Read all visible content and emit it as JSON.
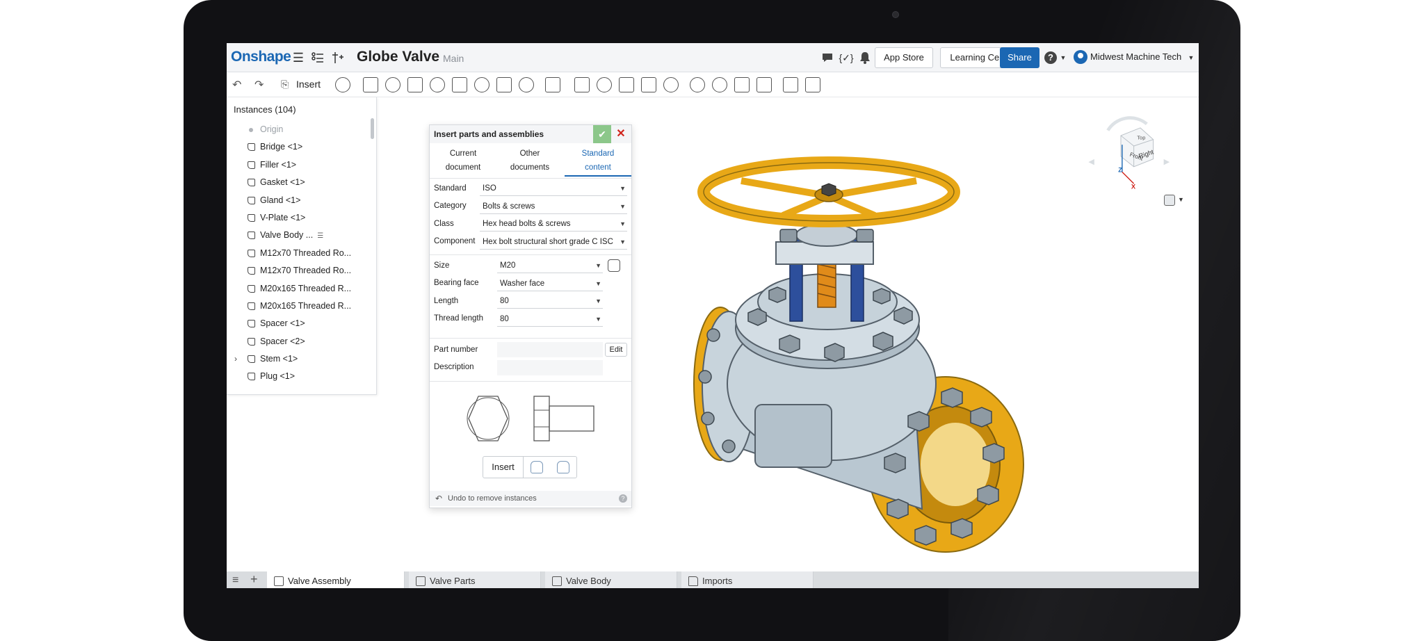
{
  "app": {
    "logo": "Onshape",
    "document_title": "Globe Valve",
    "branch": "Main"
  },
  "topbar": {
    "app_store": "App Store",
    "learning_center": "Learning Center",
    "share": "Share",
    "user": "Midwest Machine Tech",
    "help": "?"
  },
  "toolbar": {
    "insert_label": "Insert"
  },
  "instances": {
    "title": "Instances (104)",
    "items": [
      {
        "label": "Origin"
      },
      {
        "label": "Bridge <1>"
      },
      {
        "label": "Filler <1>"
      },
      {
        "label": "Gasket <1>"
      },
      {
        "label": "Gland <1>"
      },
      {
        "label": "V-Plate <1>"
      },
      {
        "label": "Valve Body ..."
      },
      {
        "label": "M12x70 Threaded Ro..."
      },
      {
        "label": "M12x70 Threaded Ro..."
      },
      {
        "label": "M20x165 Threaded R..."
      },
      {
        "label": "M20x165 Threaded R..."
      },
      {
        "label": "Spacer <1>"
      },
      {
        "label": "Spacer <2>"
      },
      {
        "label": "Stem <1>"
      },
      {
        "label": "Plug <1>"
      }
    ]
  },
  "dialog": {
    "title": "Insert parts and assemblies",
    "tabs": [
      {
        "line1": "Current",
        "line2": "document"
      },
      {
        "line1": "Other",
        "line2": "documents"
      },
      {
        "line1": "Standard",
        "line2": "content"
      }
    ],
    "fields": [
      {
        "label": "Standard",
        "value": "ISO"
      },
      {
        "label": "Category",
        "value": "Bolts & screws"
      },
      {
        "label": "Class",
        "value": "Hex head bolts & screws"
      },
      {
        "label": "Component",
        "value": "Hex bolt structural short grade C ISC"
      }
    ],
    "params": [
      {
        "label": "Size",
        "value": "M20"
      },
      {
        "label": "Bearing face",
        "value": "Washer face"
      },
      {
        "label": "Length",
        "value": "80"
      },
      {
        "label": "Thread length",
        "value": "80"
      }
    ],
    "part_number_label": "Part number",
    "description_label": "Description",
    "edit_label": "Edit",
    "insert_label": "Insert",
    "footer": "Undo to remove instances"
  },
  "viewcube": {
    "z": "Z",
    "x": "X",
    "front": "Front",
    "right": "Right",
    "top": "Top"
  },
  "bottom_tabs": [
    {
      "label": "Valve Assembly",
      "active": true
    },
    {
      "label": "Valve Parts"
    },
    {
      "label": "Valve Body"
    },
    {
      "label": "Imports"
    }
  ],
  "colors": {
    "brand": "#1b67b3",
    "accept": "#8cc78a",
    "close": "#d0241c",
    "handwheel": "#f0b020",
    "valve_body": "#c8d4dc",
    "stem_blue": "#2d4f9c"
  }
}
